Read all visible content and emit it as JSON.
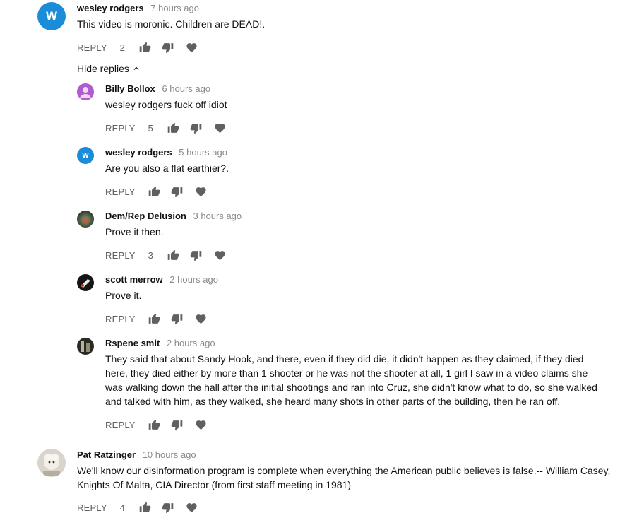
{
  "comments": [
    {
      "author": "wesley rodgers",
      "time": "7 hours ago",
      "text": "This video is moronic. Children are DEAD!.",
      "reply_label": "REPLY",
      "likes": "2",
      "avatar_letter": "W",
      "avatar_color": "#1a8cd8"
    },
    {
      "author": "Pat Ratzinger",
      "time": "10 hours ago",
      "text": "We'll know our disinformation program is complete when everything the American public believes is false.-- William Casey, Knights Of Malta, CIA Director (from first staff meeting in 1981)",
      "reply_label": "REPLY",
      "likes": "4"
    }
  ],
  "hide_replies_label": "Hide replies",
  "replies": [
    {
      "author": "Billy Bollox",
      "time": "6 hours ago",
      "text": "wesley rodgers fuck off idiot",
      "reply_label": "REPLY",
      "likes": "5",
      "avatar_color": "#b05bcf"
    },
    {
      "author": "wesley rodgers",
      "time": "5 hours ago",
      "text": "Are you also a flat earthier?.",
      "reply_label": "REPLY",
      "likes": "",
      "avatar_letter": "W",
      "avatar_color": "#1a8cd8"
    },
    {
      "author": "Dem/Rep Delusion",
      "time": "3 hours ago",
      "text": "Prove it then.",
      "reply_label": "REPLY",
      "likes": "3"
    },
    {
      "author": "scott merrow",
      "time": "2 hours ago",
      "text": "Prove it.",
      "reply_label": "REPLY",
      "likes": ""
    },
    {
      "author": "Rspene smit",
      "time": "2 hours ago",
      "text": "They said that about Sandy  Hook, and there, even if they did die, it didn't happen as they claimed, if they died here, they died either by more than 1 shooter or he was not the shooter at all, 1 girl I saw in a video claims she was walking down the hall after the initial shootings and ran into Cruz, she didn't know what to do, so she walked and talked with him, as they walked, she heard many shots in other parts of the building, then he ran off.",
      "reply_label": "REPLY",
      "likes": ""
    }
  ],
  "icons": {
    "like": "thumb-up-icon",
    "dislike": "thumb-down-icon",
    "heart": "heart-icon",
    "chevron": "chevron-up-icon"
  }
}
